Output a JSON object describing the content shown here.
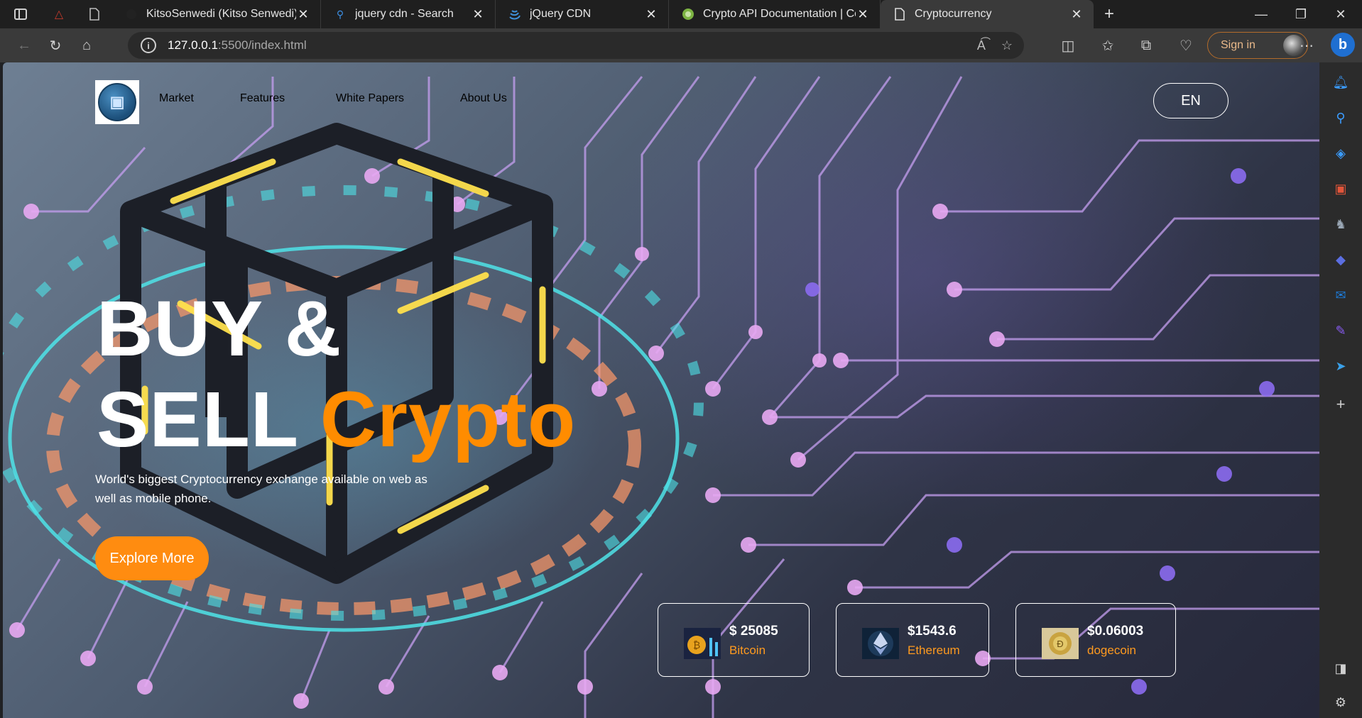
{
  "browser": {
    "tabs": [
      {
        "title": "KitsoSenwedi (Kitso Senwedi)",
        "icon": "github-icon"
      },
      {
        "title": "jquery cdn - Search",
        "icon": "search-icon"
      },
      {
        "title": "jQuery CDN",
        "icon": "jquery-icon"
      },
      {
        "title": "Crypto API Documentation | Coin",
        "icon": "coin-api-icon"
      },
      {
        "title": "Cryptocurrency",
        "icon": "page-icon",
        "active": true
      }
    ],
    "address": {
      "host": "127.0.0.1",
      "path": ":5500/index.html"
    },
    "sign_in_label": "Sign in"
  },
  "site": {
    "nav": [
      "Market",
      "Features",
      "White Papers",
      "About Us"
    ],
    "language": "EN",
    "hero": {
      "line1": "BUY &",
      "line2_white": "SELL ",
      "line2_accent": "Crypto",
      "subtitle": "World's biggest Cryptocurrency exchange available on web as well as mobile phone.",
      "cta": "Explore More"
    },
    "coins": [
      {
        "price": "$ 25085",
        "name": "Bitcoin",
        "icon": "bitcoin-icon"
      },
      {
        "price": "$1543.6",
        "name": "Ethereum",
        "icon": "ethereum-icon"
      },
      {
        "price": "$0.06003",
        "name": "dogecoin",
        "icon": "dogecoin-icon"
      }
    ]
  },
  "colors": {
    "accent": "#ff8c00",
    "tab_active": "#3a3a3a",
    "toolbar": "#3a3a3a"
  }
}
